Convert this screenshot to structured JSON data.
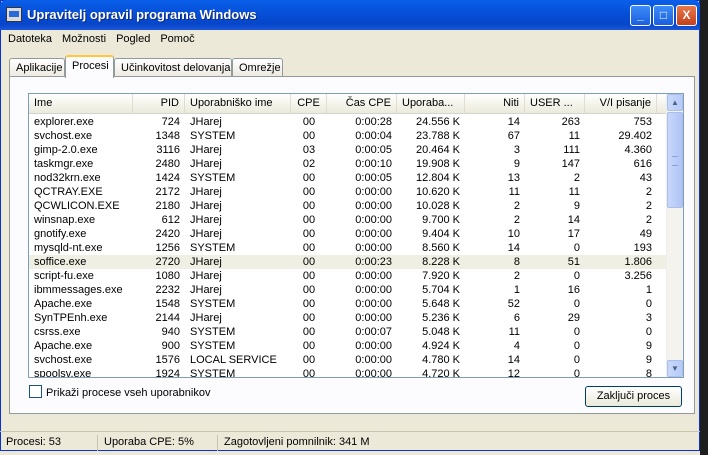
{
  "window": {
    "title": "Upravitelj opravil programa Windows",
    "controls": [
      "_",
      "□",
      "X"
    ]
  },
  "menu": [
    "Datoteka",
    "Možnosti",
    "Pogled",
    "Pomoč"
  ],
  "tabs": [
    "Aplikacije",
    "Procesi",
    "Učinkovitost delovanja",
    "Omrežje"
  ],
  "active_tab": "Procesi",
  "columns": [
    "Ime",
    "PID",
    "Uporabniško ime",
    "CPE",
    "Čas CPE",
    "Uporaba...",
    "Niti",
    "USER ...",
    "V/I pisanje"
  ],
  "rows": [
    [
      "explorer.exe",
      "724",
      "JHarej",
      "00",
      "0:00:28",
      "24.556 K",
      "14",
      "263",
      "753"
    ],
    [
      "svchost.exe",
      "1348",
      "SYSTEM",
      "00",
      "0:00:04",
      "23.788 K",
      "67",
      "11",
      "29.402"
    ],
    [
      "gimp-2.0.exe",
      "3116",
      "JHarej",
      "03",
      "0:00:05",
      "20.464 K",
      "3",
      "111",
      "4.360"
    ],
    [
      "taskmgr.exe",
      "2480",
      "JHarej",
      "02",
      "0:00:10",
      "19.908 K",
      "9",
      "147",
      "616"
    ],
    [
      "nod32krn.exe",
      "1424",
      "SYSTEM",
      "00",
      "0:00:05",
      "12.804 K",
      "13",
      "2",
      "43"
    ],
    [
      "QCTRAY.EXE",
      "2172",
      "JHarej",
      "00",
      "0:00:00",
      "10.620 K",
      "11",
      "11",
      "2"
    ],
    [
      "QCWLICON.EXE",
      "2180",
      "JHarej",
      "00",
      "0:00:00",
      "10.028 K",
      "2",
      "9",
      "2"
    ],
    [
      "winsnap.exe",
      "612",
      "JHarej",
      "00",
      "0:00:00",
      "9.700 K",
      "2",
      "14",
      "2"
    ],
    [
      "gnotify.exe",
      "2420",
      "JHarej",
      "00",
      "0:00:00",
      "9.404 K",
      "10",
      "17",
      "49"
    ],
    [
      "mysqld-nt.exe",
      "1256",
      "SYSTEM",
      "00",
      "0:00:00",
      "8.560 K",
      "14",
      "0",
      "193"
    ],
    [
      "soffice.exe",
      "2720",
      "JHarej",
      "00",
      "0:00:23",
      "8.228 K",
      "8",
      "51",
      "1.806"
    ],
    [
      "script-fu.exe",
      "1080",
      "JHarej",
      "00",
      "0:00:00",
      "7.920 K",
      "2",
      "0",
      "3.256"
    ],
    [
      "ibmmessages.exe",
      "2232",
      "JHarej",
      "00",
      "0:00:00",
      "5.704 K",
      "1",
      "16",
      "1"
    ],
    [
      "Apache.exe",
      "1548",
      "SYSTEM",
      "00",
      "0:00:00",
      "5.648 K",
      "52",
      "0",
      "0"
    ],
    [
      "SynTPEnh.exe",
      "2144",
      "JHarej",
      "00",
      "0:00:00",
      "5.236 K",
      "6",
      "29",
      "3"
    ],
    [
      "csrss.exe",
      "940",
      "SYSTEM",
      "00",
      "0:00:07",
      "5.048 K",
      "11",
      "0",
      "0"
    ],
    [
      "Apache.exe",
      "900",
      "SYSTEM",
      "00",
      "0:00:00",
      "4.924 K",
      "4",
      "0",
      "9"
    ],
    [
      "svchost.exe",
      "1576",
      "LOCAL SERVICE",
      "00",
      "0:00:00",
      "4.780 K",
      "14",
      "0",
      "9"
    ],
    [
      "spoolsv.exe",
      "1924",
      "SYSTEM",
      "00",
      "0:00:00",
      "4.720 K",
      "12",
      "0",
      "8"
    ]
  ],
  "selected_row": "soffice.exe",
  "show_all_processes": {
    "label": "Prikaži procese vseh uporabnikov",
    "checked": false
  },
  "end_process_label": "Zaključi proces",
  "status": {
    "processes": "Procesi: 53",
    "cpu": "Uporaba CPE: 5%",
    "commit": "Zagotovljeni pomnilnik: 341 M"
  },
  "colors": {
    "title_bar": "#0650d9",
    "tab_highlight": "#ffc83c",
    "selected_row": "#f0efe4"
  }
}
